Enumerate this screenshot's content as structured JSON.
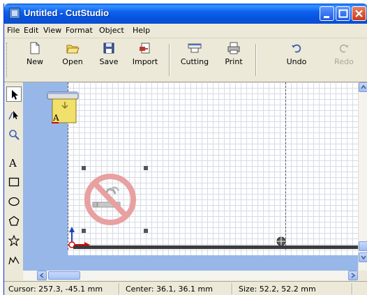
{
  "window": {
    "title": "Untitled - CutStudio"
  },
  "menu": {
    "items": [
      "File",
      "Edit",
      "View",
      "Format",
      "Object",
      "Help"
    ]
  },
  "toolbar": {
    "new_label": "New",
    "open_label": "Open",
    "save_label": "Save",
    "import_label": "Import",
    "cutting_label": "Cutting",
    "print_label": "Print",
    "undo_label": "Undo",
    "redo_label": "Redo"
  },
  "palette": {
    "text_tool_glyph": "A"
  },
  "canvas": {
    "printer_glyph": "A",
    "objects": [
      "no-smoking-sign"
    ]
  },
  "status": {
    "cursor": "Cursor: 257.3, -45.1 mm",
    "center": "Center: 36.1, 36.1 mm",
    "size": "Size: 52.2, 52.2 mm"
  },
  "colors": {
    "titlebar": "#0a5ce8",
    "margin": "#97b7e8",
    "no_smoking_red": "#e8a0a0"
  }
}
